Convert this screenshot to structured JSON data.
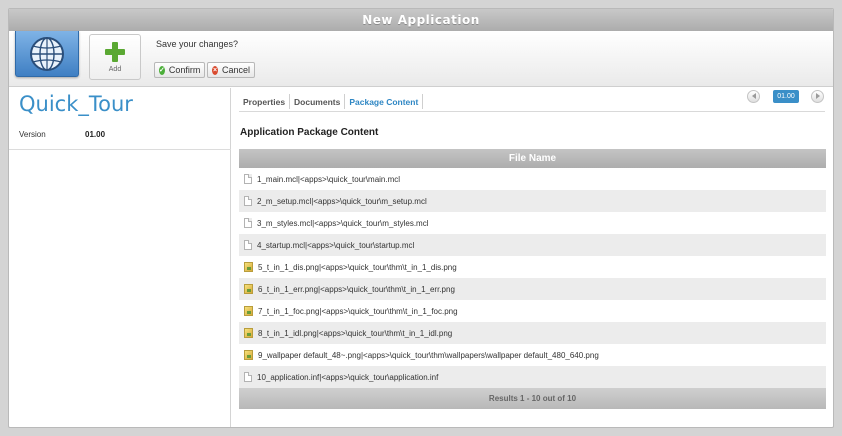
{
  "window": {
    "title": "New Application"
  },
  "toolbar": {
    "add_label": "Add",
    "save_question": "Save your changes?",
    "confirm_label": "Confirm",
    "cancel_label": "Cancel"
  },
  "app": {
    "name": "Quick_Tour",
    "version_label": "Version",
    "version_value": "01.00"
  },
  "tabs": [
    {
      "label": "Properties",
      "active": false
    },
    {
      "label": "Documents",
      "active": false
    },
    {
      "label": "Package Content",
      "active": true
    }
  ],
  "pager": {
    "version_badge": "01.00"
  },
  "content": {
    "section_title": "Application Package Content",
    "column_header": "File Name",
    "files": [
      {
        "name": "1_main.mcl|<apps>\\quick_tour\\main.mcl",
        "icon": "file-icon"
      },
      {
        "name": "2_m_setup.mcl|<apps>\\quick_tour\\m_setup.mcl",
        "icon": "file-icon"
      },
      {
        "name": "3_m_styles.mcl|<apps>\\quick_tour\\m_styles.mcl",
        "icon": "file-icon"
      },
      {
        "name": "4_startup.mcl|<apps>\\quick_tour\\startup.mcl",
        "icon": "file-icon"
      },
      {
        "name": "5_t_in_1_dis.png|<apps>\\quick_tour\\thm\\t_in_1_dis.png",
        "icon": "image-icon"
      },
      {
        "name": "6_t_in_1_err.png|<apps>\\quick_tour\\thm\\t_in_1_err.png",
        "icon": "image-icon"
      },
      {
        "name": "7_t_in_1_foc.png|<apps>\\quick_tour\\thm\\t_in_1_foc.png",
        "icon": "image-icon"
      },
      {
        "name": "8_t_in_1_idl.png|<apps>\\quick_tour\\thm\\t_in_1_idl.png",
        "icon": "image-icon"
      },
      {
        "name": "9_wallpaper default_48~.png|<apps>\\quick_tour\\thm\\wallpapers\\wallpaper default_480_640.png",
        "icon": "image-icon"
      },
      {
        "name": "10_application.inf|<apps>\\quick_tour\\application.inf",
        "icon": "file-icon"
      }
    ],
    "results_text": "Results 1 - 10 out of 10"
  },
  "colors": {
    "accent": "#3a8fc8",
    "confirm": "#4caf3a",
    "cancel": "#d94a2e"
  }
}
